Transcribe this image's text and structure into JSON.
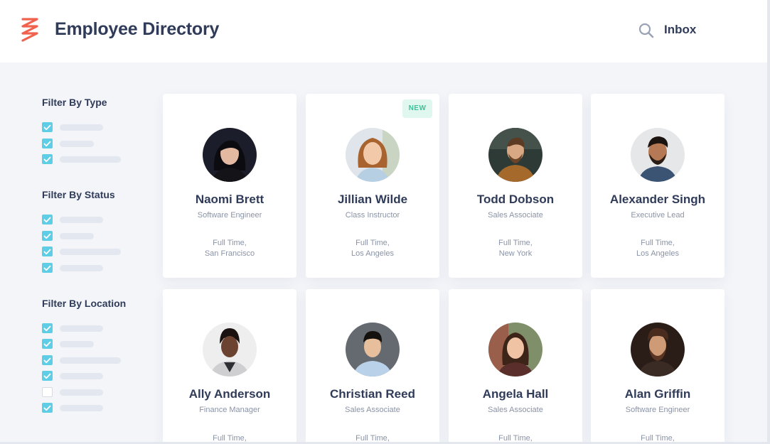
{
  "app": {
    "title": "Employee Directory",
    "inbox_label": "Inbox"
  },
  "colors": {
    "accent": "#5ecde6",
    "logo": "#f0624d",
    "heading": "#2f3b59",
    "muted": "#8a93a6",
    "badge_bg": "#dff7ef",
    "badge_text": "#3cc29a"
  },
  "filters": {
    "type": {
      "title": "Filter By Type",
      "options": [
        {
          "checked": true
        },
        {
          "checked": true
        },
        {
          "checked": true
        }
      ]
    },
    "status": {
      "title": "Filter By Status",
      "options": [
        {
          "checked": true
        },
        {
          "checked": true
        },
        {
          "checked": true
        },
        {
          "checked": true
        }
      ]
    },
    "location": {
      "title": "Filter By Location",
      "options": [
        {
          "checked": true
        },
        {
          "checked": true
        },
        {
          "checked": true
        },
        {
          "checked": true
        },
        {
          "checked": false
        },
        {
          "checked": true
        }
      ]
    }
  },
  "employees": [
    {
      "name": "Naomi Brett",
      "role": "Software Engineer",
      "employment": "Full Time,",
      "location": "San Francisco",
      "badge": ""
    },
    {
      "name": "Jillian Wilde",
      "role": "Class Instructor",
      "employment": "Full Time,",
      "location": "Los Angeles",
      "badge": "NEW"
    },
    {
      "name": "Todd Dobson",
      "role": "Sales Associate",
      "employment": "Full Time,",
      "location": "New York",
      "badge": ""
    },
    {
      "name": "Alexander Singh",
      "role": "Executive Lead",
      "employment": "Full Time,",
      "location": "Los Angeles",
      "badge": ""
    },
    {
      "name": "Ally Anderson",
      "role": "Finance Manager",
      "employment": "Full Time,",
      "location": "",
      "badge": ""
    },
    {
      "name": "Christian Reed",
      "role": "Sales Associate",
      "employment": "Full Time,",
      "location": "",
      "badge": ""
    },
    {
      "name": "Angela Hall",
      "role": "Sales Associate",
      "employment": "Full Time,",
      "location": "",
      "badge": ""
    },
    {
      "name": "Alan Griffin",
      "role": "Software Engineer",
      "employment": "Full Time,",
      "location": "",
      "badge": ""
    }
  ]
}
